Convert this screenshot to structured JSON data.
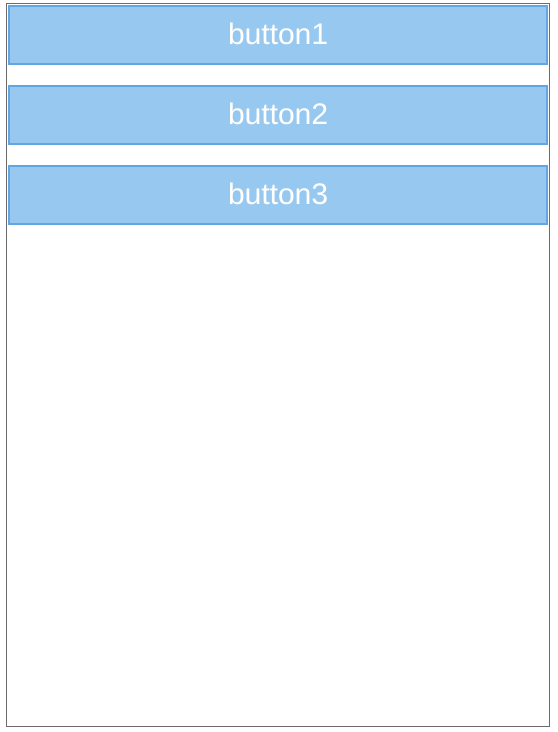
{
  "buttons": [
    {
      "label": "button1"
    },
    {
      "label": "button2"
    },
    {
      "label": "button3"
    }
  ],
  "colors": {
    "button_fill": "#97c8f0",
    "button_border": "#63a4e3",
    "button_text": "#ffffff",
    "frame_border": "#6b6b6b",
    "background": "#ffffff"
  }
}
